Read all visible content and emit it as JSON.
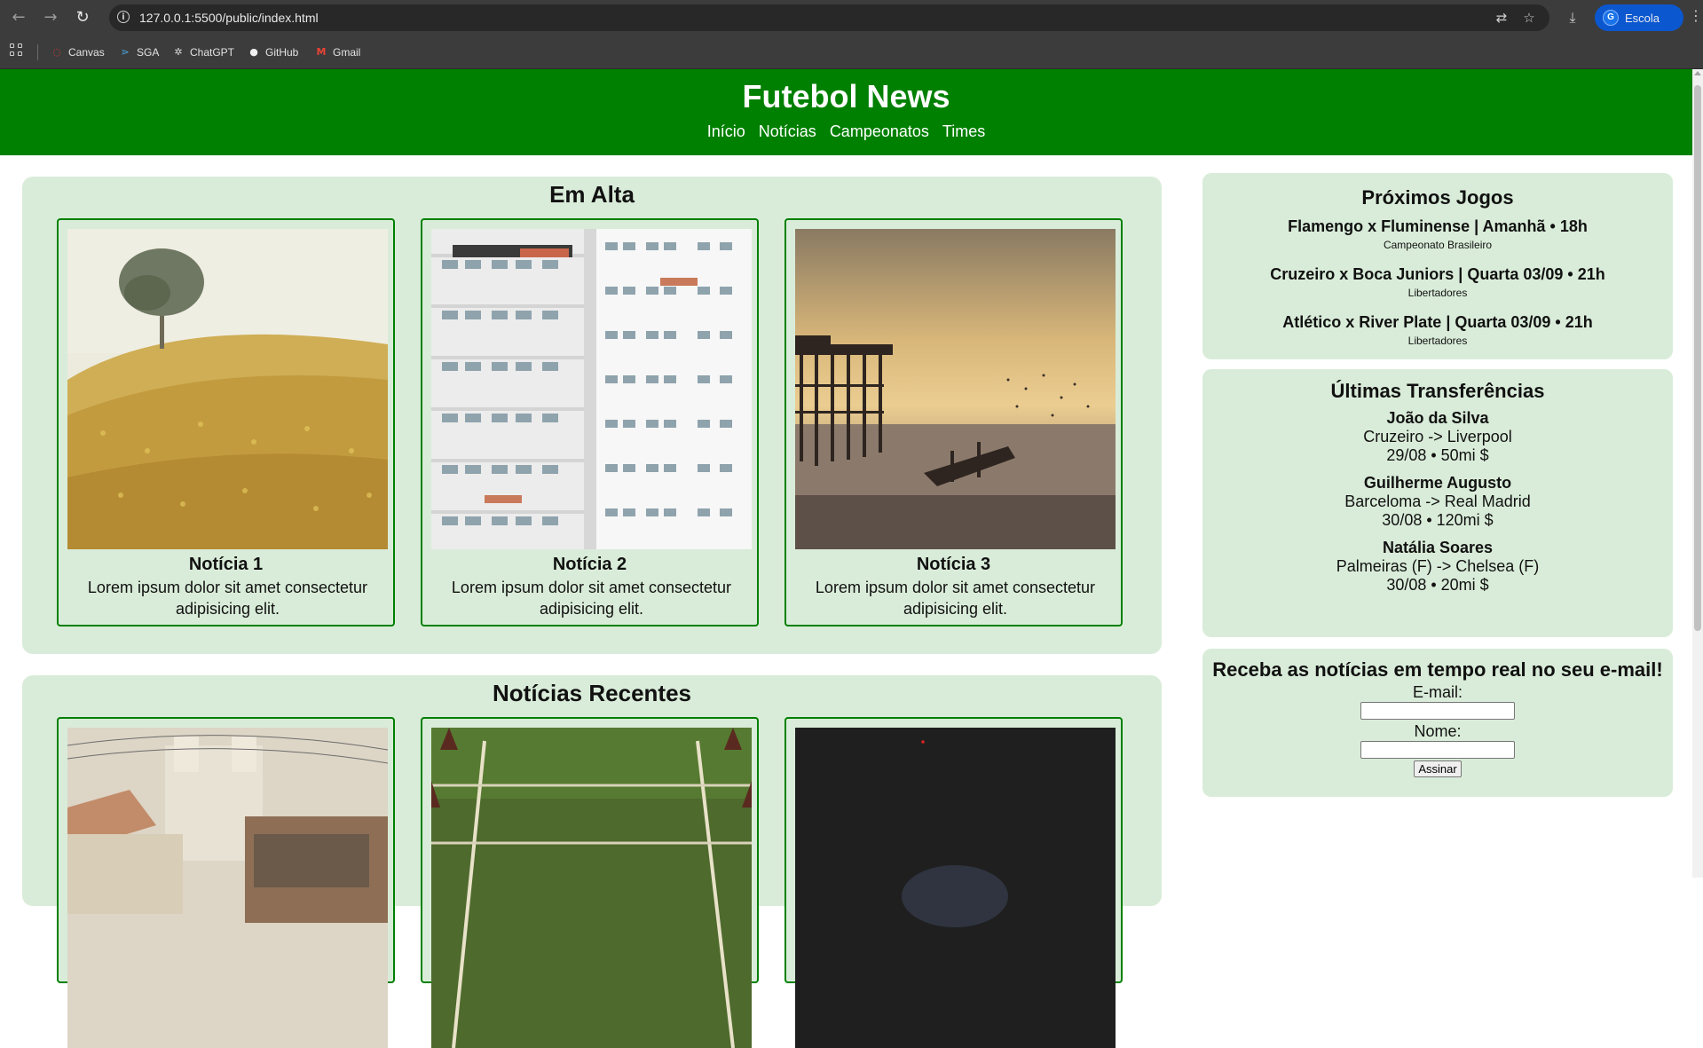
{
  "browser": {
    "url": "127.0.0.1:5500/public/index.html",
    "profile_initial": "G",
    "profile_label": "Escola",
    "bookmarks": [
      {
        "label": "Canvas"
      },
      {
        "label": "SGA"
      },
      {
        "label": "ChatGPT"
      },
      {
        "label": "GitHub"
      },
      {
        "label": "Gmail"
      }
    ]
  },
  "header": {
    "title": "Futebol News",
    "nav": [
      "Início",
      "Notícias",
      "Campeonatos",
      "Times"
    ]
  },
  "em_alta": {
    "title": "Em Alta",
    "cards": [
      {
        "title": "Notícia 1",
        "text": "Lorem ipsum dolor sit amet consectetur adipisicing elit."
      },
      {
        "title": "Notícia 2",
        "text": "Lorem ipsum dolor sit amet consectetur adipisicing elit."
      },
      {
        "title": "Notícia 3",
        "text": "Lorem ipsum dolor sit amet consectetur adipisicing elit."
      }
    ]
  },
  "recentes": {
    "title": "Notícias Recentes"
  },
  "proximos_jogos": {
    "title": "Próximos Jogos",
    "games": [
      {
        "match": "Flamengo x Fluminense | Amanhã • 18h",
        "league": "Campeonato Brasileiro"
      },
      {
        "match": "Cruzeiro x Boca Juniors | Quarta 03/09 • 21h",
        "league": "Libertadores"
      },
      {
        "match": "Atlético x River Plate | Quarta 03/09 • 21h",
        "league": "Libertadores"
      }
    ]
  },
  "transferencias": {
    "title": "Últimas Transferências",
    "items": [
      {
        "name": "João da Silva",
        "move": "Cruzeiro -> Liverpool",
        "info": "29/08 • 50mi $"
      },
      {
        "name": "Guilherme Augusto",
        "move": "Barceloma -> Real Madrid",
        "info": "30/08 • 120mi $"
      },
      {
        "name": "Natália Soares",
        "move": "Palmeiras (F) -> Chelsea (F)",
        "info": "30/08 • 20mi $"
      }
    ]
  },
  "newsletter": {
    "title": "Receba as notícias em tempo real no seu e-mail!",
    "email_label": "E-mail:",
    "name_label": "Nome:",
    "submit_label": "Assinar"
  }
}
